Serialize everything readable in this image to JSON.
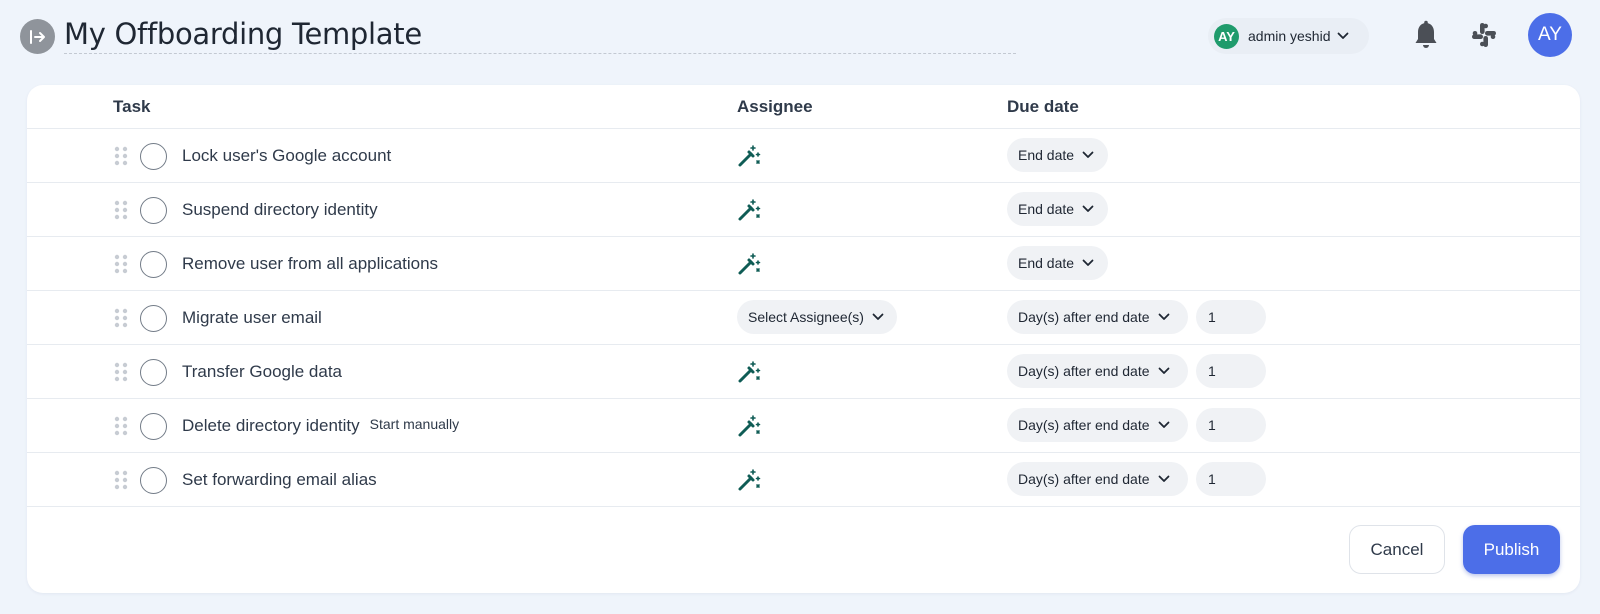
{
  "header": {
    "title": "My Offboarding Template",
    "user": {
      "initials": "AY",
      "name": "admin yeshid"
    },
    "avatar_initials": "AY",
    "icons": [
      "exit-icon",
      "chevron-down-icon",
      "bell-icon",
      "slack-icon"
    ]
  },
  "table": {
    "columns": {
      "task": "Task",
      "assignee": "Assignee",
      "due": "Due date"
    },
    "rows": [
      {
        "task": "Lock user's Google account",
        "tag": "",
        "assignee_type": "auto",
        "due": "End date",
        "days": ""
      },
      {
        "task": "Suspend directory identity",
        "tag": "",
        "assignee_type": "auto",
        "due": "End date",
        "days": ""
      },
      {
        "task": "Remove user from all applications",
        "tag": "",
        "assignee_type": "auto",
        "due": "End date",
        "days": ""
      },
      {
        "task": "Migrate user email",
        "tag": "",
        "assignee_type": "select",
        "assignee_label": "Select Assignee(s)",
        "due": "Day(s) after end date",
        "days": "1"
      },
      {
        "task": "Transfer Google data",
        "tag": "",
        "assignee_type": "auto",
        "due": "Day(s) after end date",
        "days": "1"
      },
      {
        "task": "Delete directory identity",
        "tag": "Start manually",
        "assignee_type": "auto",
        "due": "Day(s) after end date",
        "days": "1"
      },
      {
        "task": "Set forwarding email alias",
        "tag": "",
        "assignee_type": "auto",
        "due": "Day(s) after end date",
        "days": "1"
      }
    ]
  },
  "footer": {
    "cancel_label": "Cancel",
    "publish_label": "Publish"
  },
  "colors": {
    "background": "#eff4fb",
    "primary": "#4c6ee8",
    "wand": "#0f5c55",
    "user_badge": "#1f9b6c"
  }
}
